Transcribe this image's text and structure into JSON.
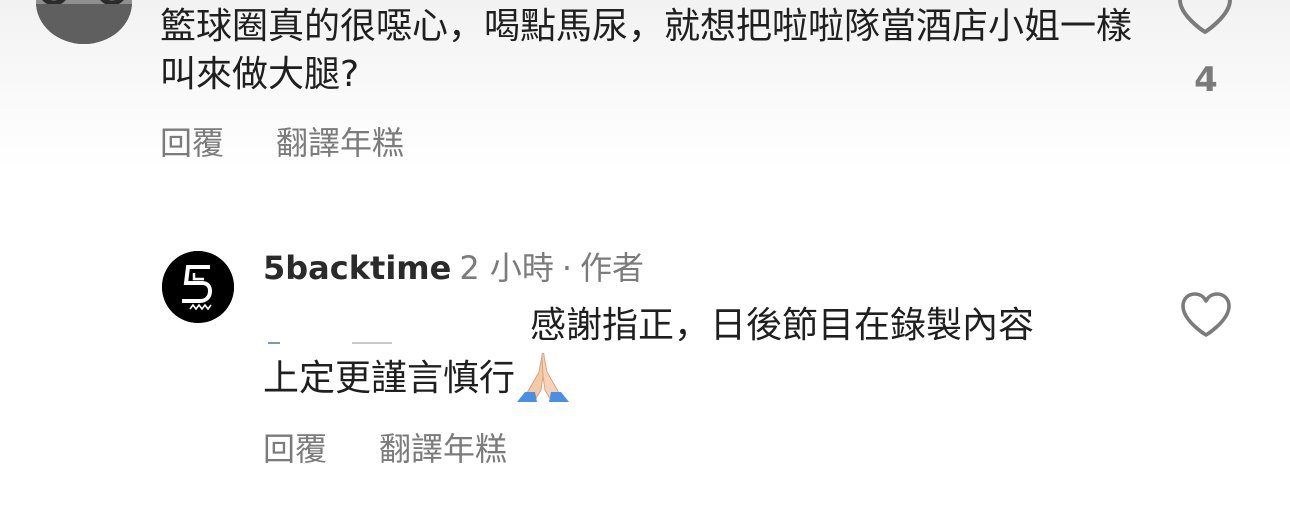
{
  "comments": [
    {
      "text": "籃球圈真的很噁心，喝點馬尿，就想把啦啦隊當酒店小姐一樣叫來做大腿?",
      "like_count": "4",
      "actions": {
        "reply_label": "回覆",
        "translate_label": "翻譯年糕"
      }
    },
    {
      "username": "5backtime",
      "time_label": "2 小時",
      "separator": "·",
      "author_badge": "作者",
      "text_line1": "感謝指正，日後節目在錄製內容",
      "text_line2": "上定更謹言慎行",
      "emoji": "praying-hands",
      "actions": {
        "reply_label": "回覆",
        "translate_label": "翻譯年糕"
      }
    }
  ],
  "colors": {
    "text_primary": "#1f1f1f",
    "text_secondary": "#7b7b7b",
    "avatar_bg_reply": "#000000",
    "heart_outline": "#7b7b7b"
  },
  "icons": {
    "like": "heart-outline-icon",
    "emoji": "praying-hands-icon"
  }
}
